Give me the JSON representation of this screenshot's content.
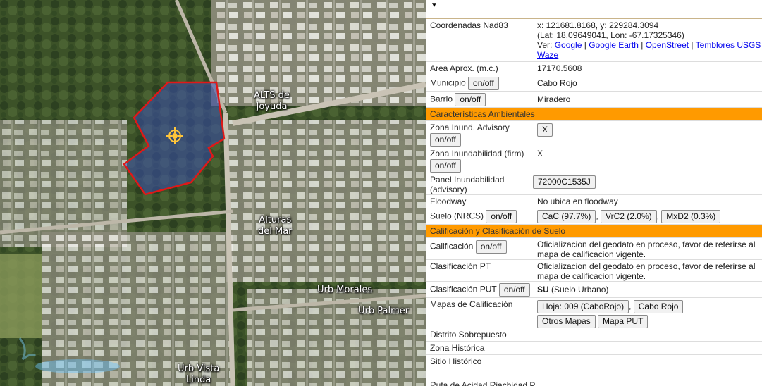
{
  "map": {
    "labels": {
      "alts": "ALTS de\nJoyuda",
      "alturas": "Alturas\ndel Mar",
      "morales": "Urb Morales",
      "palmer": "Urb Palmer",
      "vista": "Urb Vista\nLinda"
    },
    "colors": {
      "parcel_stroke": "#e01818",
      "parcel_fill": "#3a4fb0",
      "marker": "#ffc53a"
    }
  },
  "panel": {
    "coords_label": "Coordenadas Nad83",
    "coords_xy": "x: 121681.8168, y: 229284.3094",
    "coords_latlon": "(Lat: 18.09649041, Lon: -67.17325346)",
    "ver_label": "Ver:",
    "links": [
      "Google",
      "Google Earth",
      "OpenStreet",
      "Temblores USGS",
      "Waze"
    ],
    "area_label": "Area Aprox. (m.c.)",
    "area_value": "17170.5608",
    "municipio_label": "Municipio",
    "municipio_value": "Cabo Rojo",
    "barrio_label": "Barrio",
    "barrio_value": "Miradero",
    "onoff": "on/off",
    "hdr_ambientales": "Características Ambientales",
    "zona_adv_label": "Zona Inund. Advisory",
    "zona_adv_value": "X",
    "zona_firm_label": "Zona Inundabilidad (firm)",
    "zona_firm_value": "X",
    "panel_label": "Panel Inundabilidad (advisory)",
    "panel_value": "72000C1535J",
    "floodway_label": "Floodway",
    "floodway_value": "No ubica en floodway",
    "suelo_label": "Suelo (NRCS)",
    "suelo_values": [
      "CaC (97.7%)",
      "VrC2 (2.0%)",
      "MxD2 (0.3%)"
    ],
    "hdr_calificacion": "Calificación y Clasificación de Suelo",
    "calificacion_label": "Calificación",
    "calificacion_value": "Oficializacion del geodato en proceso, favor de referirse al mapa de calificacion vigente.",
    "clasif_pt_label": "Clasificación PT",
    "clasif_pt_value": "Oficializacion del geodato en proceso, favor de referirse al mapa de calificacion vigente.",
    "clasif_put_label": "Clasificación PUT",
    "clasif_put_code": "SU",
    "clasif_put_desc": "(Suelo Urbano)",
    "mapas_label": "Mapas de Calificación",
    "mapas_buttons": [
      "Hoja: 009 (CaboRojo)",
      "Cabo Rojo",
      "Otros Mapas",
      "Mapa PUT"
    ],
    "distrito_label": "Distrito Sobrepuesto",
    "zona_hist_label": "Zona Histórica",
    "sitio_hist_label": "Sitio Histórico",
    "cut_row": "Ruta de Acidad                     Riachidad P..."
  }
}
